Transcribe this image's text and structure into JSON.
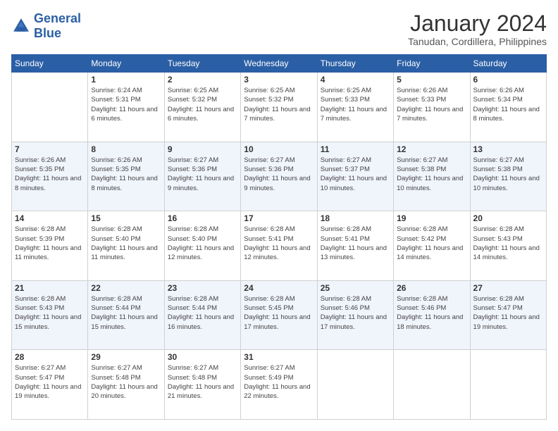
{
  "logo": {
    "line1": "General",
    "line2": "Blue"
  },
  "title": "January 2024",
  "subtitle": "Tanudan, Cordillera, Philippines",
  "days_of_week": [
    "Sunday",
    "Monday",
    "Tuesday",
    "Wednesday",
    "Thursday",
    "Friday",
    "Saturday"
  ],
  "weeks": [
    [
      {
        "day": "",
        "sunrise": "",
        "sunset": "",
        "daylight": ""
      },
      {
        "day": "1",
        "sunrise": "Sunrise: 6:24 AM",
        "sunset": "Sunset: 5:31 PM",
        "daylight": "Daylight: 11 hours and 6 minutes."
      },
      {
        "day": "2",
        "sunrise": "Sunrise: 6:25 AM",
        "sunset": "Sunset: 5:32 PM",
        "daylight": "Daylight: 11 hours and 6 minutes."
      },
      {
        "day": "3",
        "sunrise": "Sunrise: 6:25 AM",
        "sunset": "Sunset: 5:32 PM",
        "daylight": "Daylight: 11 hours and 7 minutes."
      },
      {
        "day": "4",
        "sunrise": "Sunrise: 6:25 AM",
        "sunset": "Sunset: 5:33 PM",
        "daylight": "Daylight: 11 hours and 7 minutes."
      },
      {
        "day": "5",
        "sunrise": "Sunrise: 6:26 AM",
        "sunset": "Sunset: 5:33 PM",
        "daylight": "Daylight: 11 hours and 7 minutes."
      },
      {
        "day": "6",
        "sunrise": "Sunrise: 6:26 AM",
        "sunset": "Sunset: 5:34 PM",
        "daylight": "Daylight: 11 hours and 8 minutes."
      }
    ],
    [
      {
        "day": "7",
        "sunrise": "Sunrise: 6:26 AM",
        "sunset": "Sunset: 5:35 PM",
        "daylight": "Daylight: 11 hours and 8 minutes."
      },
      {
        "day": "8",
        "sunrise": "Sunrise: 6:26 AM",
        "sunset": "Sunset: 5:35 PM",
        "daylight": "Daylight: 11 hours and 8 minutes."
      },
      {
        "day": "9",
        "sunrise": "Sunrise: 6:27 AM",
        "sunset": "Sunset: 5:36 PM",
        "daylight": "Daylight: 11 hours and 9 minutes."
      },
      {
        "day": "10",
        "sunrise": "Sunrise: 6:27 AM",
        "sunset": "Sunset: 5:36 PM",
        "daylight": "Daylight: 11 hours and 9 minutes."
      },
      {
        "day": "11",
        "sunrise": "Sunrise: 6:27 AM",
        "sunset": "Sunset: 5:37 PM",
        "daylight": "Daylight: 11 hours and 10 minutes."
      },
      {
        "day": "12",
        "sunrise": "Sunrise: 6:27 AM",
        "sunset": "Sunset: 5:38 PM",
        "daylight": "Daylight: 11 hours and 10 minutes."
      },
      {
        "day": "13",
        "sunrise": "Sunrise: 6:27 AM",
        "sunset": "Sunset: 5:38 PM",
        "daylight": "Daylight: 11 hours and 10 minutes."
      }
    ],
    [
      {
        "day": "14",
        "sunrise": "Sunrise: 6:28 AM",
        "sunset": "Sunset: 5:39 PM",
        "daylight": "Daylight: 11 hours and 11 minutes."
      },
      {
        "day": "15",
        "sunrise": "Sunrise: 6:28 AM",
        "sunset": "Sunset: 5:40 PM",
        "daylight": "Daylight: 11 hours and 11 minutes."
      },
      {
        "day": "16",
        "sunrise": "Sunrise: 6:28 AM",
        "sunset": "Sunset: 5:40 PM",
        "daylight": "Daylight: 11 hours and 12 minutes."
      },
      {
        "day": "17",
        "sunrise": "Sunrise: 6:28 AM",
        "sunset": "Sunset: 5:41 PM",
        "daylight": "Daylight: 11 hours and 12 minutes."
      },
      {
        "day": "18",
        "sunrise": "Sunrise: 6:28 AM",
        "sunset": "Sunset: 5:41 PM",
        "daylight": "Daylight: 11 hours and 13 minutes."
      },
      {
        "day": "19",
        "sunrise": "Sunrise: 6:28 AM",
        "sunset": "Sunset: 5:42 PM",
        "daylight": "Daylight: 11 hours and 14 minutes."
      },
      {
        "day": "20",
        "sunrise": "Sunrise: 6:28 AM",
        "sunset": "Sunset: 5:43 PM",
        "daylight": "Daylight: 11 hours and 14 minutes."
      }
    ],
    [
      {
        "day": "21",
        "sunrise": "Sunrise: 6:28 AM",
        "sunset": "Sunset: 5:43 PM",
        "daylight": "Daylight: 11 hours and 15 minutes."
      },
      {
        "day": "22",
        "sunrise": "Sunrise: 6:28 AM",
        "sunset": "Sunset: 5:44 PM",
        "daylight": "Daylight: 11 hours and 15 minutes."
      },
      {
        "day": "23",
        "sunrise": "Sunrise: 6:28 AM",
        "sunset": "Sunset: 5:44 PM",
        "daylight": "Daylight: 11 hours and 16 minutes."
      },
      {
        "day": "24",
        "sunrise": "Sunrise: 6:28 AM",
        "sunset": "Sunset: 5:45 PM",
        "daylight": "Daylight: 11 hours and 17 minutes."
      },
      {
        "day": "25",
        "sunrise": "Sunrise: 6:28 AM",
        "sunset": "Sunset: 5:46 PM",
        "daylight": "Daylight: 11 hours and 17 minutes."
      },
      {
        "day": "26",
        "sunrise": "Sunrise: 6:28 AM",
        "sunset": "Sunset: 5:46 PM",
        "daylight": "Daylight: 11 hours and 18 minutes."
      },
      {
        "day": "27",
        "sunrise": "Sunrise: 6:28 AM",
        "sunset": "Sunset: 5:47 PM",
        "daylight": "Daylight: 11 hours and 19 minutes."
      }
    ],
    [
      {
        "day": "28",
        "sunrise": "Sunrise: 6:27 AM",
        "sunset": "Sunset: 5:47 PM",
        "daylight": "Daylight: 11 hours and 19 minutes."
      },
      {
        "day": "29",
        "sunrise": "Sunrise: 6:27 AM",
        "sunset": "Sunset: 5:48 PM",
        "daylight": "Daylight: 11 hours and 20 minutes."
      },
      {
        "day": "30",
        "sunrise": "Sunrise: 6:27 AM",
        "sunset": "Sunset: 5:48 PM",
        "daylight": "Daylight: 11 hours and 21 minutes."
      },
      {
        "day": "31",
        "sunrise": "Sunrise: 6:27 AM",
        "sunset": "Sunset: 5:49 PM",
        "daylight": "Daylight: 11 hours and 22 minutes."
      },
      {
        "day": "",
        "sunrise": "",
        "sunset": "",
        "daylight": ""
      },
      {
        "day": "",
        "sunrise": "",
        "sunset": "",
        "daylight": ""
      },
      {
        "day": "",
        "sunrise": "",
        "sunset": "",
        "daylight": ""
      }
    ]
  ]
}
